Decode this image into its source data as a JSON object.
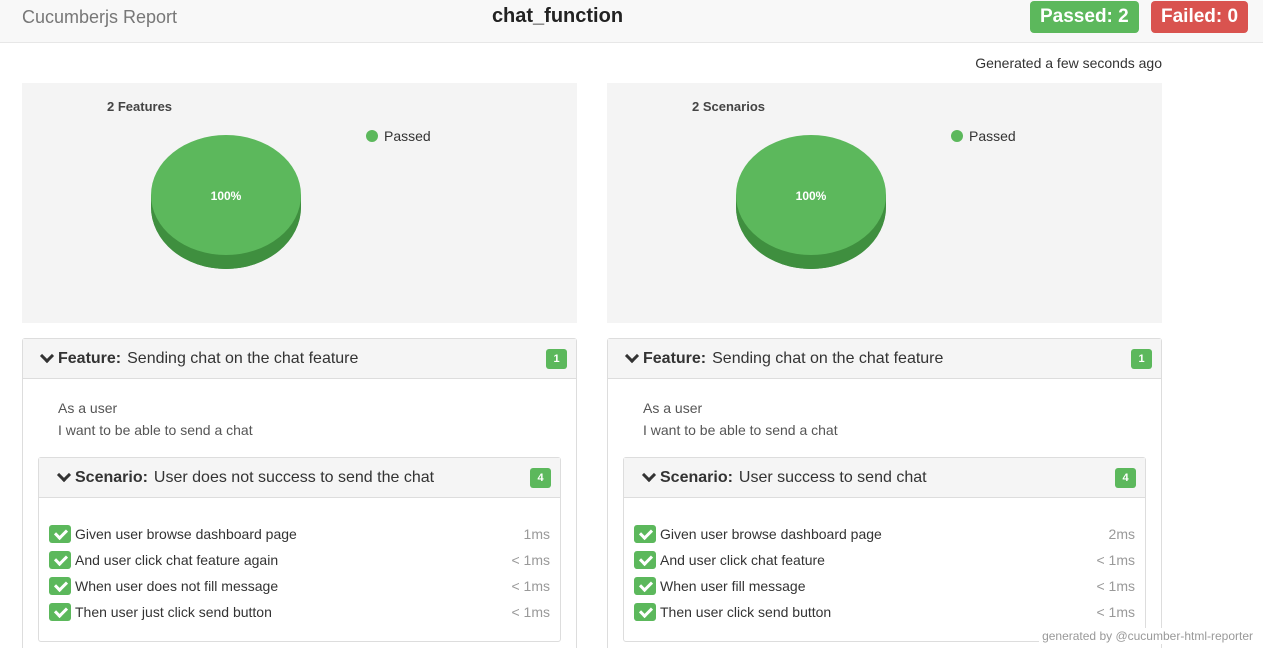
{
  "header": {
    "brand": "Cucumberjs Report",
    "title": "chat_function",
    "passed": "Passed: 2",
    "failed": "Failed: 0"
  },
  "generated": "Generated a few seconds ago",
  "colors": {
    "passed": "#5cb85c",
    "failed": "#d9534f"
  },
  "charts": [
    {
      "count_label": "2 Features",
      "legend": "Passed",
      "pie_label": "100%"
    },
    {
      "count_label": "2 Scenarios",
      "legend": "Passed",
      "pie_label": "100%"
    }
  ],
  "chart_data": [
    {
      "type": "pie",
      "title": "2 Features",
      "categories": [
        "Passed"
      ],
      "values": [
        100
      ],
      "legend_position": "top-right"
    },
    {
      "type": "pie",
      "title": "2 Scenarios",
      "categories": [
        "Passed"
      ],
      "values": [
        100
      ],
      "legend_position": "top-right"
    }
  ],
  "features": [
    {
      "keyword": "Feature:",
      "name": "Sending chat on the chat feature",
      "count": "1",
      "description": [
        "As a user",
        "I want to be able to send a chat"
      ],
      "scenario": {
        "keyword": "Scenario:",
        "name": "User does not success to send the chat",
        "count": "4",
        "steps": [
          {
            "text": "Given user browse dashboard page",
            "duration": "1ms"
          },
          {
            "text": "And user click chat feature again",
            "duration": "< 1ms"
          },
          {
            "text": "When user does not fill message",
            "duration": "< 1ms"
          },
          {
            "text": "Then user just click send button",
            "duration": "< 1ms"
          }
        ]
      }
    },
    {
      "keyword": "Feature:",
      "name": "Sending chat on the chat feature",
      "count": "1",
      "description": [
        "As a user",
        "I want to be able to send a chat"
      ],
      "scenario": {
        "keyword": "Scenario:",
        "name": "User success to send chat",
        "count": "4",
        "steps": [
          {
            "text": "Given user browse dashboard page",
            "duration": "2ms"
          },
          {
            "text": "And user click chat feature",
            "duration": "< 1ms"
          },
          {
            "text": "When user fill message",
            "duration": "< 1ms"
          },
          {
            "text": "Then user click send button",
            "duration": "< 1ms"
          }
        ]
      }
    }
  ],
  "footer": "generated by @cucumber-html-reporter"
}
